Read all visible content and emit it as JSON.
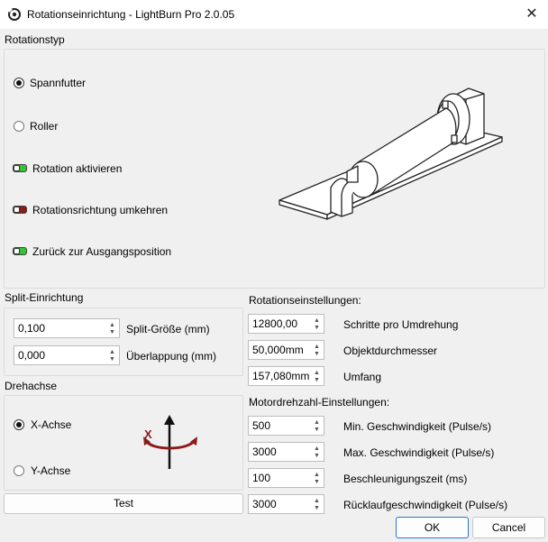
{
  "window": {
    "title": "Rotationseinrichtung - LightBurn Pro 2.0.05",
    "close_glyph": "✕"
  },
  "rotary_type": {
    "heading": "Rotationstyp",
    "options": [
      {
        "label": "Spannfutter",
        "checked": true
      },
      {
        "label": "Roller",
        "checked": false
      }
    ],
    "toggles": [
      {
        "label": "Rotation aktivieren",
        "on": true
      },
      {
        "label": "Rotationsrichtung umkehren",
        "on": false
      },
      {
        "label": "Zurück zur Ausgangsposition",
        "on": true
      }
    ]
  },
  "split": {
    "heading": "Split-Einrichtung",
    "fields": [
      {
        "value": "0,100",
        "label": "Split-Größe (mm)"
      },
      {
        "value": "0,000",
        "label": "Überlappung (mm)"
      }
    ]
  },
  "axis": {
    "heading": "Drehachse",
    "options": [
      {
        "label": "X-Achse",
        "checked": true
      },
      {
        "label": "Y-Achse",
        "checked": false
      }
    ],
    "illustration_letter": "X",
    "test_button": "Test"
  },
  "rotation_settings": {
    "heading": "Rotationseinstellungen:",
    "fields": [
      {
        "value": "12800,00",
        "label": "Schritte pro Umdrehung"
      },
      {
        "value": "50,000mm",
        "label": "Objektdurchmesser"
      },
      {
        "value": "157,080mm",
        "label": "Umfang"
      }
    ]
  },
  "motor_speed": {
    "heading": "Motordrehzahl-Einstellungen:",
    "fields": [
      {
        "value": "500",
        "label": "Min. Geschwindigkeit (Pulse/s)"
      },
      {
        "value": "3000",
        "label": "Max. Geschwindigkeit (Pulse/s)"
      },
      {
        "value": "100",
        "label": "Beschleunigungszeit (ms)"
      },
      {
        "value": "3000",
        "label": "Rücklaufgeschwindigkeit (Pulse/s)"
      }
    ]
  },
  "footer": {
    "ok": "OK",
    "cancel": "Cancel"
  },
  "icons": {
    "app": "lightburn-rotary-icon",
    "close": "close-icon",
    "chuck": "chuck-rotary-illustration",
    "axis": "rotation-axis-illustration"
  },
  "colors": {
    "toggle_on": "#33c433",
    "toggle_off": "#8b1a1a",
    "axis_red": "#8b1a1a",
    "default_button_border": "#2a74d6"
  }
}
